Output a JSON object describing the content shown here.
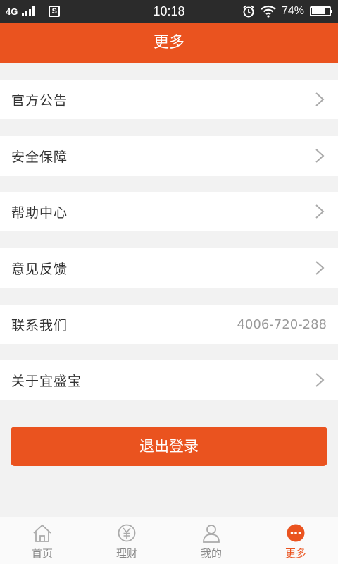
{
  "status_bar": {
    "network": "4G",
    "time": "10:18",
    "battery": "74%",
    "battery_level": 0.74
  },
  "header": {
    "title": "更多"
  },
  "menu": [
    {
      "label": "官方公告",
      "value": "",
      "chevron": true
    },
    {
      "label": "安全保障",
      "value": "",
      "chevron": true
    },
    {
      "label": "帮助中心",
      "value": "",
      "chevron": true
    },
    {
      "label": "意见反馈",
      "value": "",
      "chevron": true
    },
    {
      "label": "联系我们",
      "value": "4006-720-288",
      "chevron": false
    },
    {
      "label": "关于宜盛宝",
      "value": "",
      "chevron": true
    }
  ],
  "logout_label": "退出登录",
  "tabbar": [
    {
      "label": "首页",
      "icon": "home-icon",
      "active": false
    },
    {
      "label": "理财",
      "icon": "yen-icon",
      "active": false
    },
    {
      "label": "我的",
      "icon": "user-icon",
      "active": false
    },
    {
      "label": "更多",
      "icon": "more-icon",
      "active": true
    }
  ],
  "colors": {
    "accent": "#ea531f",
    "background": "#f2f2f2",
    "status_bar": "#2b2b2b"
  }
}
